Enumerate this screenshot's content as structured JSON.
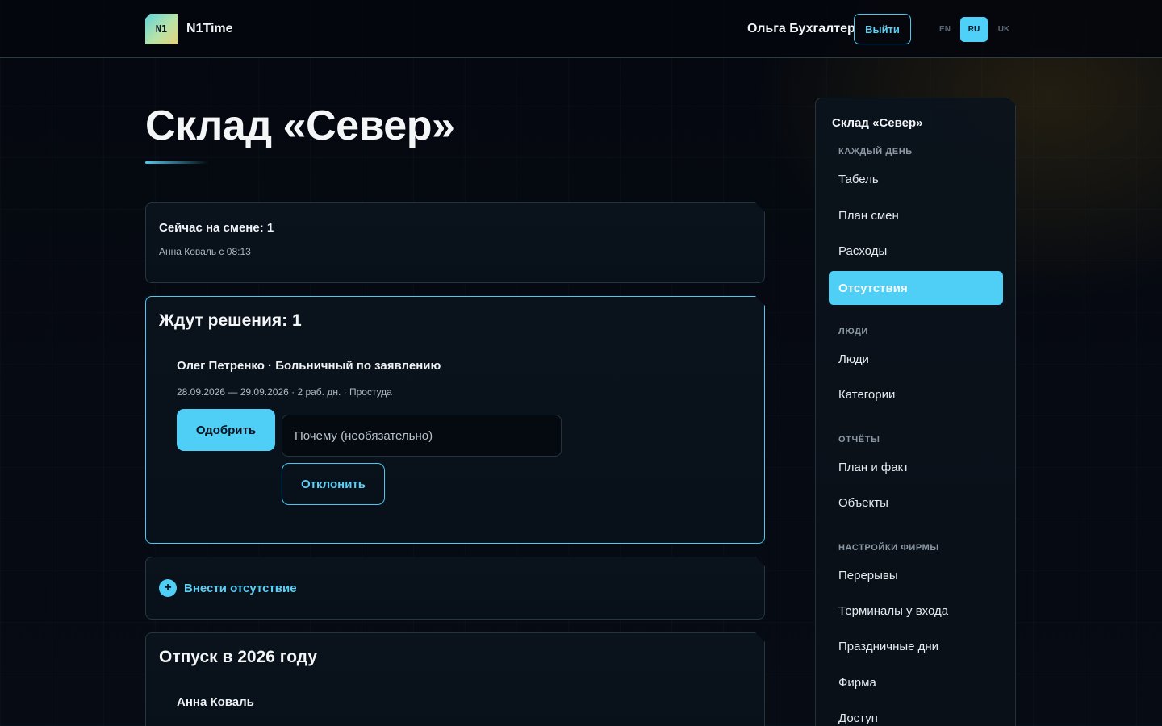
{
  "header": {
    "logo_mark": "N1",
    "logo_text": "N1Time",
    "user_name": "Ольга Бухгалтер",
    "logout_label": "Выйти",
    "languages": [
      "EN",
      "RU",
      "UK"
    ],
    "active_language": "RU"
  },
  "main": {
    "title": "Склад «Север»",
    "on_shift": {
      "heading": "Сейчас на смене: 1",
      "detail": "Анна Коваль с 08:13"
    },
    "pending": {
      "heading": "Ждут решения: 1",
      "request_title": "Олег Петренко · Больничный по заявлению",
      "request_meta": "28.09.2026 — 29.09.2026 · 2 раб. дн. · Простуда",
      "approve_label": "Одобрить",
      "reason_placeholder": "Почему (необязательно)",
      "reject_label": "Отклонить"
    },
    "add_absence_label": "Внести отсутствие",
    "vacation": {
      "heading": "Отпуск в 2026 году",
      "person": "Анна Коваль"
    }
  },
  "sidebar": {
    "title": "Склад «Север»",
    "sections": [
      {
        "label": "КАЖДЫЙ ДЕНЬ",
        "items": [
          "Табель",
          "План смен",
          "Расходы",
          "Отсутствия"
        ]
      },
      {
        "label": "ЛЮДИ",
        "items": [
          "Люди",
          "Категории"
        ]
      },
      {
        "label": "ОТЧЁТЫ",
        "items": [
          "План и факт",
          "Объекты"
        ]
      },
      {
        "label": "НАСТРОЙКИ ФИРМЫ",
        "items": [
          "Перерывы",
          "Терминалы у входа",
          "Праздничные дни",
          "Фирма",
          "Доступ"
        ]
      }
    ],
    "active_item": "Отсутствия"
  },
  "colors": {
    "accent": "#4fcff5",
    "background": "#05080f",
    "card": "#0a121c"
  }
}
